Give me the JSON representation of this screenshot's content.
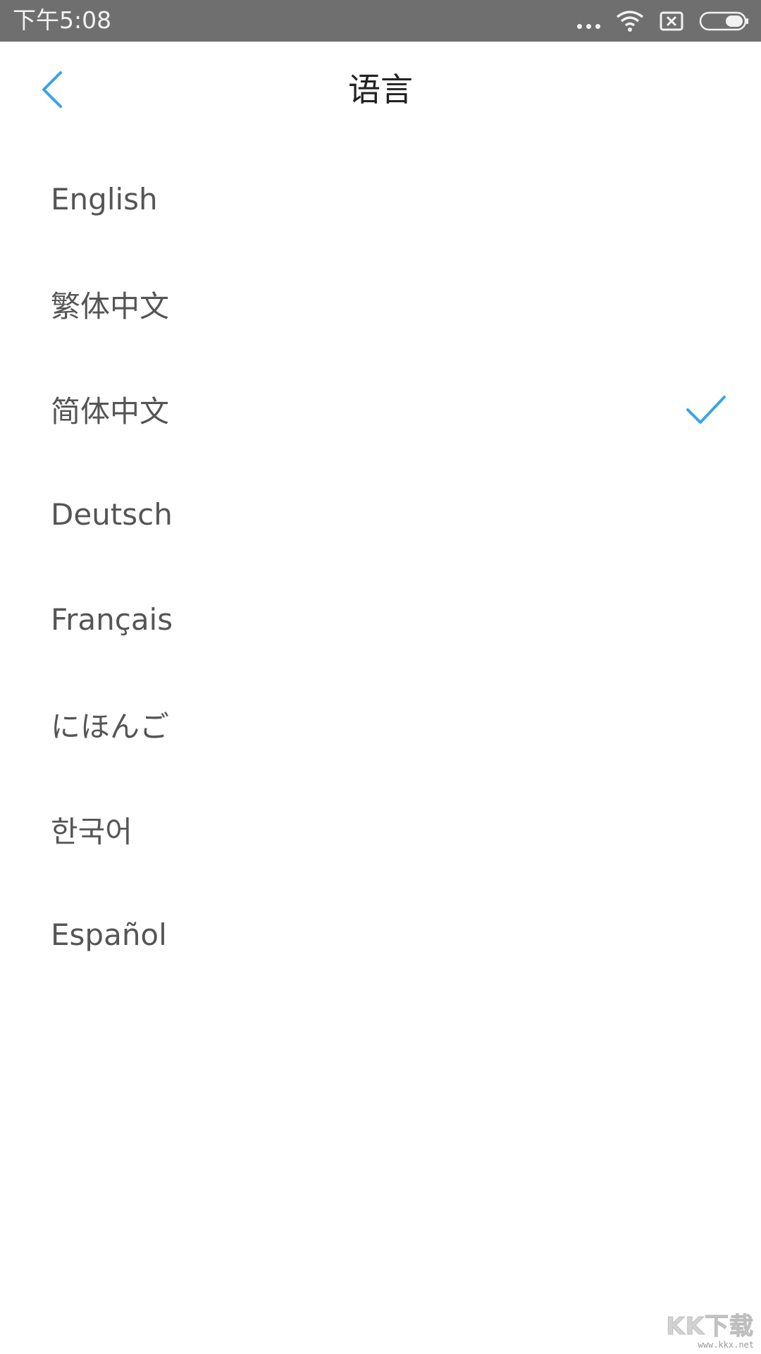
{
  "status_bar": {
    "time": "下午5:08",
    "icons": [
      "more-dots-icon",
      "wifi-icon",
      "sim-x-icon",
      "battery-icon"
    ]
  },
  "header": {
    "title": "语言",
    "back_icon": "chevron-left-icon"
  },
  "languages": [
    {
      "label": "English",
      "selected": false
    },
    {
      "label": "繁体中文",
      "selected": false
    },
    {
      "label": "简体中文",
      "selected": true
    },
    {
      "label": "Deutsch",
      "selected": false
    },
    {
      "label": "Français",
      "selected": false
    },
    {
      "label": "にほんご",
      "selected": false
    },
    {
      "label": "한국어",
      "selected": false
    },
    {
      "label": "Español",
      "selected": false
    }
  ],
  "watermark": {
    "logo": "KK下载",
    "url": "www.kkx.net"
  },
  "colors": {
    "accent": "#3aa3e3",
    "status_bar_bg": "#6f6f6f",
    "text_primary": "#222222",
    "text_item": "#555555"
  }
}
